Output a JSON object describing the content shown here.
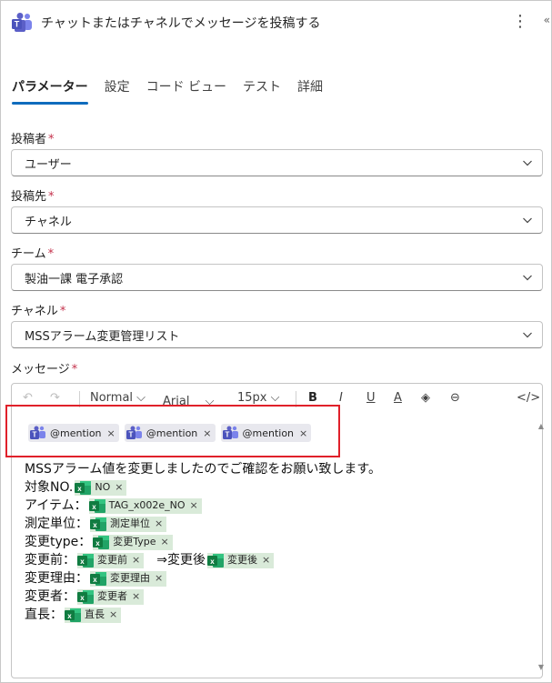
{
  "header": {
    "title": "チャットまたはチャネルでメッセージを投稿する",
    "more_label": "⋮",
    "extra_label": "«"
  },
  "tabs": [
    {
      "label": "パラメーター",
      "active": true
    },
    {
      "label": "設定",
      "active": false
    },
    {
      "label": "コード ビュー",
      "active": false
    },
    {
      "label": "テスト",
      "active": false
    },
    {
      "label": "詳細",
      "active": false
    }
  ],
  "fields": {
    "poster": {
      "label": "投稿者",
      "required": "*",
      "value": "ユーザー"
    },
    "post_in": {
      "label": "投稿先",
      "required": "*",
      "value": "チャネル"
    },
    "team": {
      "label": "チーム",
      "required": "*",
      "value": "製油一課 電子承認"
    },
    "channel": {
      "label": "チャネル",
      "required": "*",
      "value": "MSSアラーム変更管理リスト"
    },
    "message": {
      "label": "メッセージ",
      "required": "*"
    }
  },
  "toolbar": {
    "undo": "↶",
    "redo": "↷",
    "paragraph": "Normal",
    "font": "Arial",
    "size": "15px",
    "bold": "B",
    "italic": "I",
    "underline": "U",
    "font_color": "A",
    "highlight": "◈",
    "link": "⊖",
    "code": "</>"
  },
  "mentions": [
    {
      "label": "@mention",
      "remove": "×"
    },
    {
      "label": "@mention",
      "remove": "×"
    },
    {
      "label": "@mention",
      "remove": "×"
    }
  ],
  "message_body": {
    "intro": "MSSアラーム値を変更しましたのでご確認をお願い致します。",
    "lines": [
      {
        "prefix": "対象NO.",
        "token": "NO"
      },
      {
        "prefix": "アイテム：",
        "token": "TAG_x002e_NO"
      },
      {
        "prefix": "測定単位：",
        "token": "測定単位"
      },
      {
        "prefix": "変更type：",
        "token": "変更Type"
      },
      {
        "prefix": "変更前：",
        "token": "変更前",
        "mid": "　⇒変更後",
        "token2": "変更後"
      },
      {
        "prefix": "変更理由：",
        "token": "変更理由"
      },
      {
        "prefix": "変更者：",
        "token": "変更者"
      },
      {
        "prefix": "直長：",
        "token": "直長"
      }
    ],
    "remove": "×"
  },
  "colors": {
    "accent": "#0f6cbd",
    "highlight_border": "#e0202a",
    "token_bg": "#d9ead9",
    "excel_green": "#107c41",
    "teams_purple": "#5b5fc7"
  }
}
